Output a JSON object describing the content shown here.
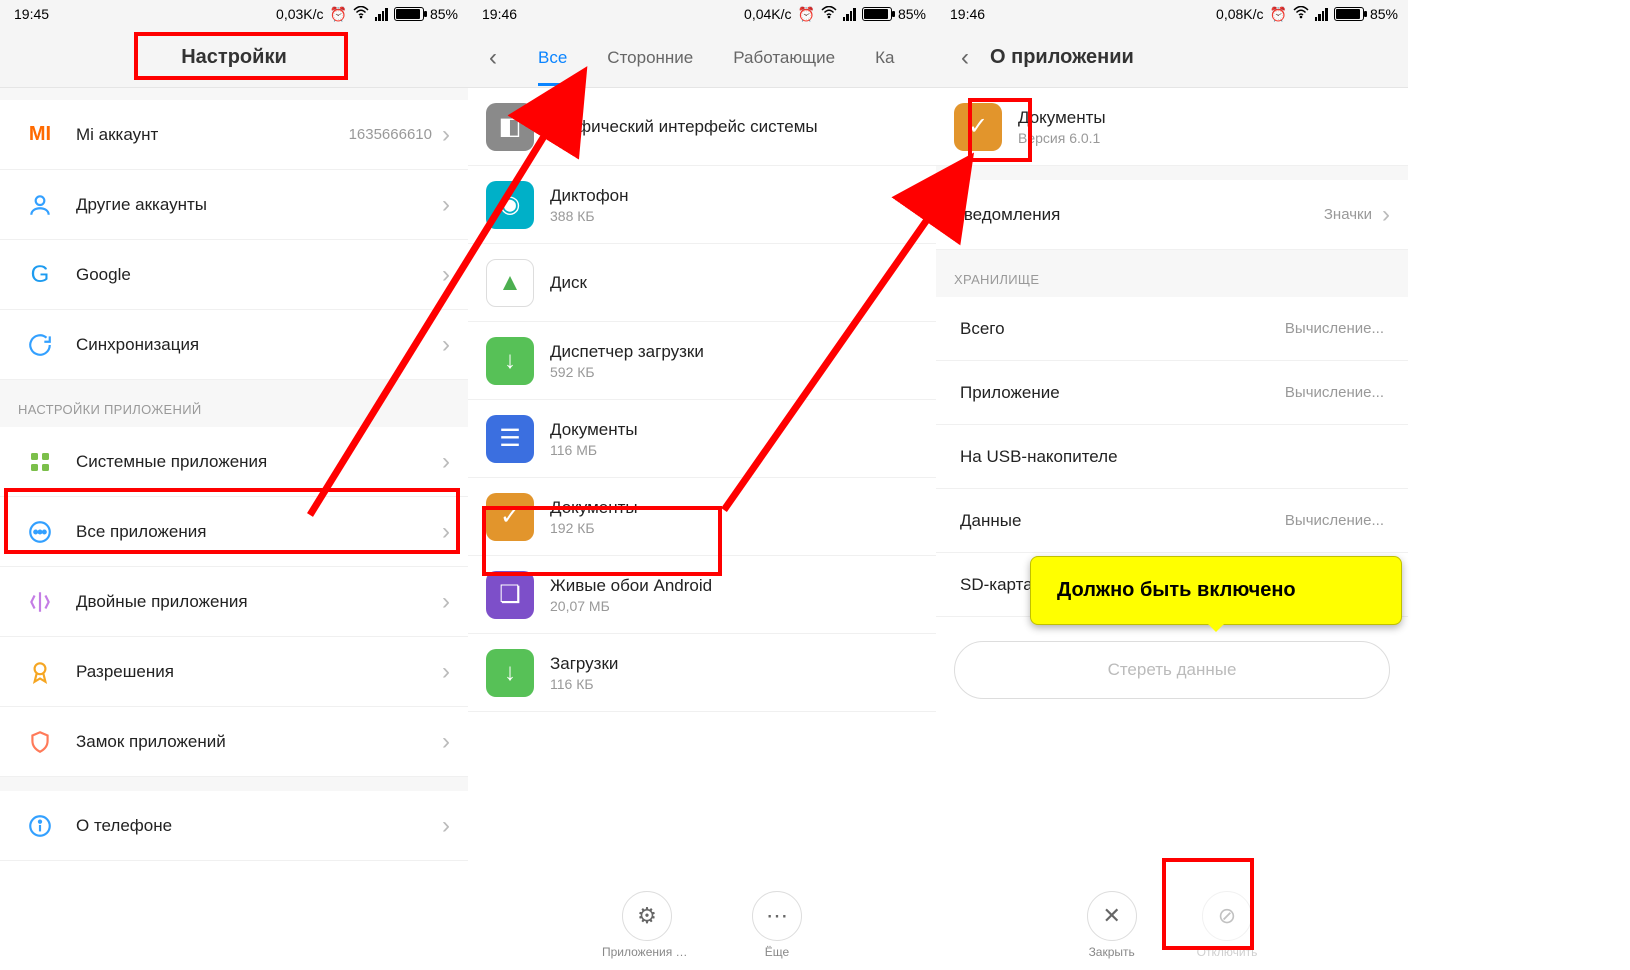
{
  "screen1": {
    "status": {
      "time": "19:45",
      "net": "0,03K/c",
      "battery": "85%"
    },
    "title": "Настройки",
    "rows": [
      {
        "icon": "mi",
        "color": "#ff6a00",
        "title": "Mi аккаунт",
        "value": "1635666610"
      },
      {
        "icon": "user",
        "color": "#33a0ff",
        "title": "Другие аккаунты"
      },
      {
        "icon": "G",
        "color": "#1d9bf0",
        "title": "Google"
      },
      {
        "icon": "sync",
        "color": "#33a0ff",
        "title": "Синхронизация"
      }
    ],
    "section": "НАСТРОЙКИ ПРИЛОЖЕНИЙ",
    "rows2": [
      {
        "icon": "grid",
        "color": "#7bbf4a",
        "title": "Системные приложения"
      },
      {
        "icon": "dots",
        "color": "#33a0ff",
        "title": "Все приложения"
      },
      {
        "icon": "twin",
        "color": "#c47de5",
        "title": "Двойные приложения"
      },
      {
        "icon": "medal",
        "color": "#f5a623",
        "title": "Разрешения"
      },
      {
        "icon": "lock",
        "color": "#ff7a59",
        "title": "Замок приложений"
      }
    ],
    "rows3": [
      {
        "icon": "info",
        "color": "#33a0ff",
        "title": "О телефоне"
      }
    ]
  },
  "screen2": {
    "status": {
      "time": "19:46",
      "net": "0,04K/c",
      "battery": "85%"
    },
    "tabs": [
      "Все",
      "Сторонние",
      "Работающие",
      "Ка"
    ],
    "apps": [
      {
        "bg": "#8a8a8a",
        "glyph": "◧",
        "title": "Графический интерфейс системы",
        "sub": ""
      },
      {
        "bg": "#00b0c8",
        "glyph": "◉",
        "title": "Диктофон",
        "sub": "388 КБ"
      },
      {
        "bg": "#ffffff",
        "glyph": "▲",
        "title": "Диск",
        "sub": ""
      },
      {
        "bg": "#57c157",
        "glyph": "↓",
        "title": "Диспетчер загрузки",
        "sub": "592 КБ"
      },
      {
        "bg": "#3b6fe0",
        "glyph": "☰",
        "title": "Документы",
        "sub": "116 МБ"
      },
      {
        "bg": "#e2952c",
        "glyph": "✓",
        "title": "Документы",
        "sub": "192 КБ"
      },
      {
        "bg": "#7d4fc9",
        "glyph": "❏",
        "title": "Живые обои Android",
        "sub": "20,07 МБ"
      },
      {
        "bg": "#57c157",
        "glyph": "↓",
        "title": "Загрузки",
        "sub": "116 КБ"
      }
    ],
    "buttons": [
      {
        "glyph": "⚙",
        "label": "Приложения по умо…"
      },
      {
        "glyph": "⋯",
        "label": "Ёще"
      }
    ]
  },
  "screen3": {
    "status": {
      "time": "19:46",
      "net": "0,08K/c",
      "battery": "85%"
    },
    "title": "О приложении",
    "app": {
      "name": "Документы",
      "version": "Версия 6.0.1"
    },
    "notify": {
      "label": "Уведомления",
      "value": "Значки"
    },
    "section": "ХРАНИЛИЩЕ",
    "kv": [
      {
        "k": "Всего",
        "v": "Вычисление..."
      },
      {
        "k": "Приложение",
        "v": "Вычисление..."
      },
      {
        "k": "На USB-накопителе",
        "v": ""
      },
      {
        "k": "Данные",
        "v": "Вычисление..."
      },
      {
        "k": "SD-карта",
        "v": ""
      }
    ],
    "erase": "Стереть данные",
    "buttons": [
      {
        "glyph": "✕",
        "label": "Закрыть"
      },
      {
        "glyph": "⊘",
        "label": "Отключить"
      }
    ],
    "callout": "Должно быть включено"
  }
}
